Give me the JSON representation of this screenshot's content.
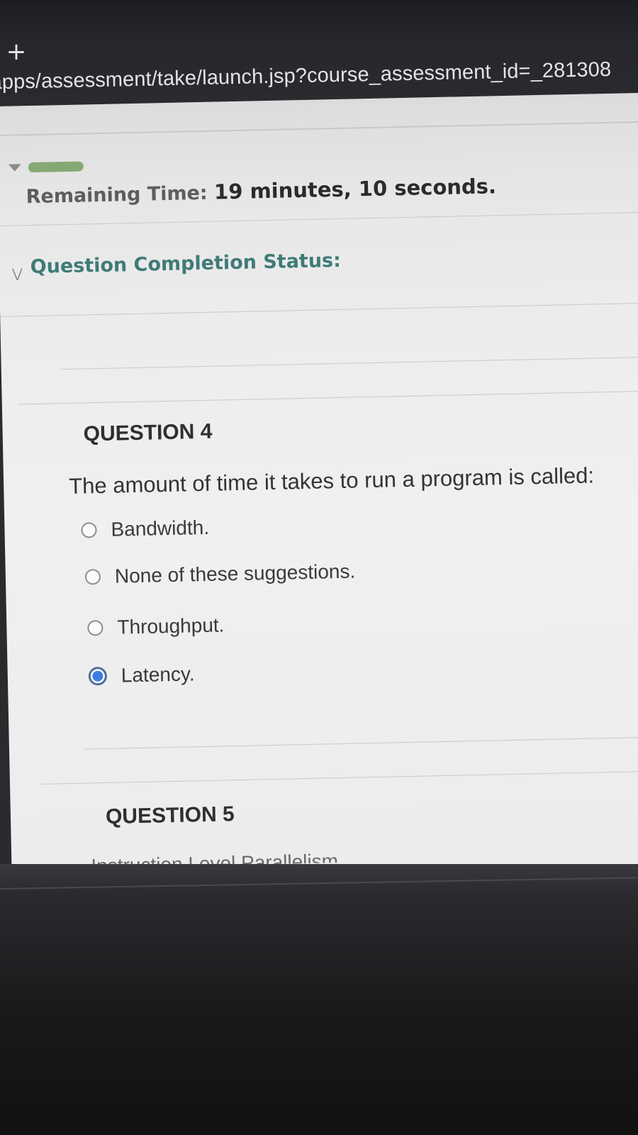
{
  "browser": {
    "url": "apps/assessment/take/launch.jsp?course_assessment_id=_281308"
  },
  "header": {
    "progress_fraction": 1.0,
    "timer_label": "Remaining Time:",
    "timer_value": "19 minutes, 10 seconds.",
    "status_label": "Question Completion Status:"
  },
  "questions": [
    {
      "title": "QUESTION 4",
      "text": "The amount of time it takes to run a program is called:",
      "options": [
        {
          "label": "Bandwidth.",
          "selected": false
        },
        {
          "label": "None of these suggestions.",
          "selected": false
        },
        {
          "label": "Throughput.",
          "selected": false
        },
        {
          "label": "Latency.",
          "selected": true
        }
      ]
    },
    {
      "title": "QUESTION 5",
      "text": "Instruction Level Parallelism"
    }
  ],
  "colors": {
    "status_label": "#3f7b78",
    "radio_selected": "#3b7fe0",
    "progress": "#86a874"
  }
}
